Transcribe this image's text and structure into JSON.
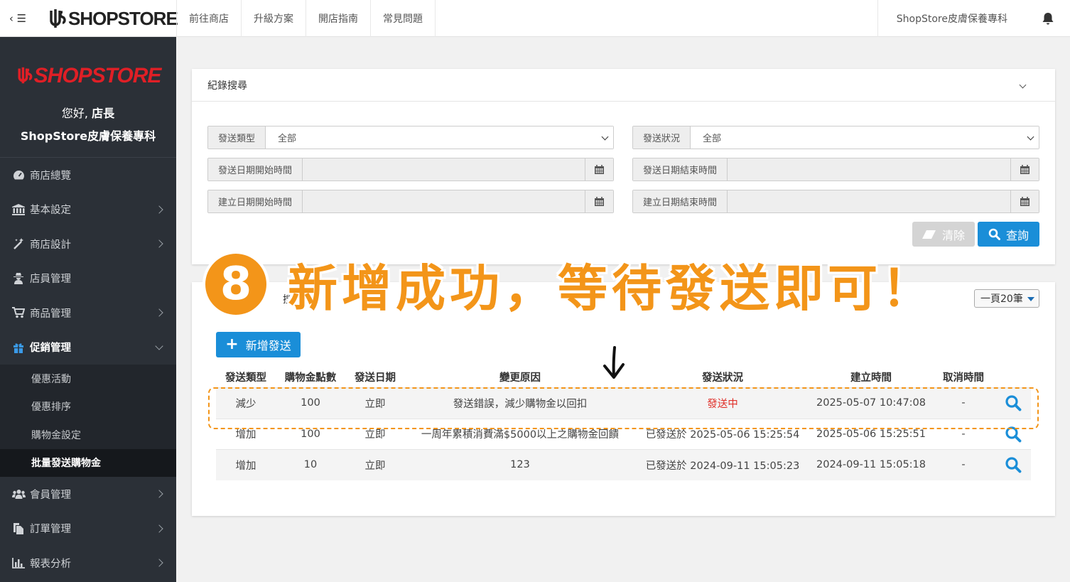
{
  "topbar": {
    "logo": "SHOPSTORE",
    "nav": [
      "前往商店",
      "升級方案",
      "開店指南",
      "常見問題"
    ],
    "store_name": "ShopStore皮膚保養專科"
  },
  "sidebar": {
    "logo": "SHOPSTORE",
    "greeting_prefix": "您好,",
    "greeting_role": "店長",
    "store_name": "ShopStore皮膚保養專科",
    "items": [
      {
        "label": "商店總覽"
      },
      {
        "label": "基本設定"
      },
      {
        "label": "商店設計"
      },
      {
        "label": "店員管理"
      },
      {
        "label": "商品管理"
      },
      {
        "label": "促銷管理"
      },
      {
        "label": "會員管理"
      },
      {
        "label": "訂單管理"
      },
      {
        "label": "報表分析"
      }
    ],
    "sub_items": [
      {
        "label": "優惠活動"
      },
      {
        "label": "優惠排序"
      },
      {
        "label": "購物金設定"
      },
      {
        "label": "批量發送購物金"
      }
    ]
  },
  "search_panel": {
    "title": "紀錄搜尋",
    "fields": {
      "send_type_label": "發送類型",
      "send_type_value": "全部",
      "send_status_label": "發送狀況",
      "send_status_value": "全部",
      "send_start_label": "發送日期開始時間",
      "send_end_label": "發送日期結束時間",
      "create_start_label": "建立日期開始時間",
      "create_end_label": "建立日期結束時間"
    },
    "clear_label": "清除",
    "search_label": "查詢"
  },
  "list_panel": {
    "page_size": "一頁20筆",
    "partial_a": "搜",
    "add_label": "新增發送",
    "columns": [
      "發送類型",
      "購物金點數",
      "發送日期",
      "變更原因",
      "發送狀況",
      "建立時間",
      "取消時間"
    ],
    "rows": [
      {
        "type": "減少",
        "points": "100",
        "date": "立即",
        "reason": "發送錯誤，減少購物金以回扣",
        "status": "發送中",
        "created": "2025-05-07 10:47:08",
        "cancelled": "-"
      },
      {
        "type": "增加",
        "points": "100",
        "date": "立即",
        "reason": "一周年累積消費滿$5000以上之購物金回饋",
        "status": "已發送於 2025-05-06 15:25:54",
        "created": "2025-05-06 15:25:51",
        "cancelled": "-"
      },
      {
        "type": "增加",
        "points": "10",
        "date": "立即",
        "reason": "123",
        "status": "已發送於 2024-09-11 15:05:23",
        "created": "2024-09-11 15:05:18",
        "cancelled": "-"
      }
    ]
  },
  "annotation": {
    "step": "8",
    "text": "新增成功，等待發送即可！"
  },
  "colors": {
    "accent_orange": "#f39519",
    "primary_blue": "#1a8ed8",
    "sidebar_bg": "#2b3037",
    "status_red": "#e0302a",
    "brand_red": "#e01f26"
  }
}
